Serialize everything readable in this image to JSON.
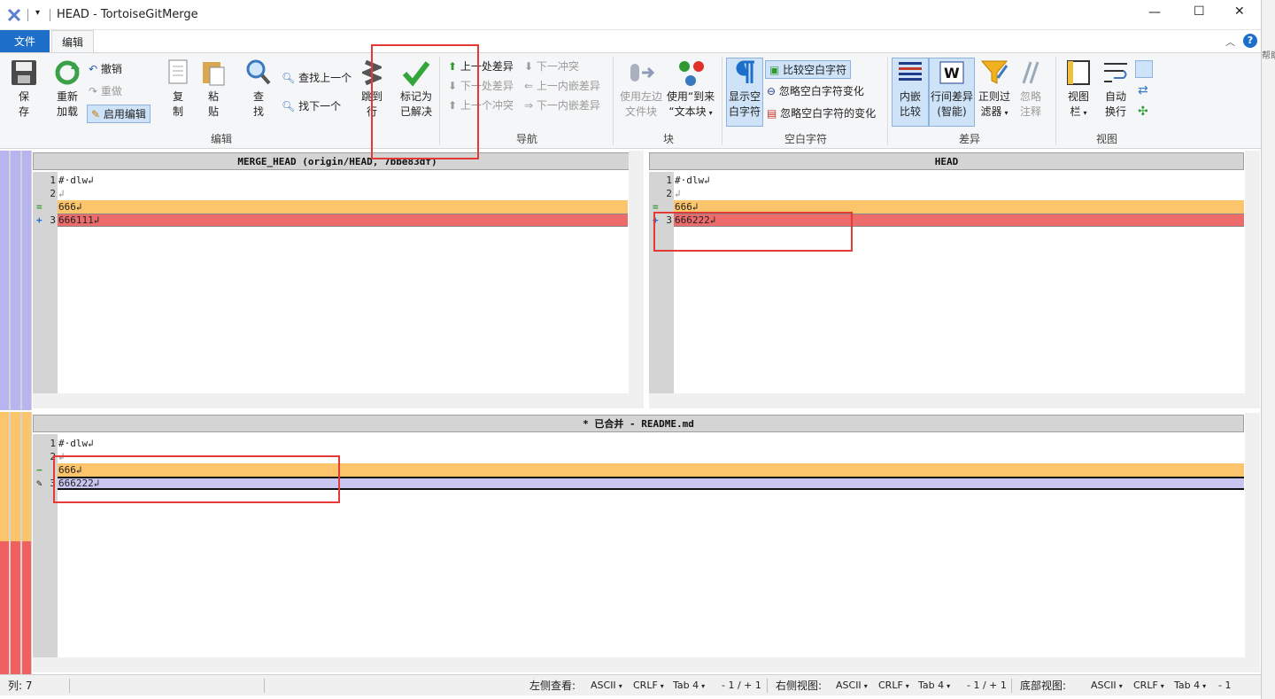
{
  "window": {
    "title": "HEAD - TortoiseGitMerge",
    "minimize": "—",
    "maximize": "☐",
    "close": "✕"
  },
  "ribbon_tabs": {
    "file": "文件",
    "edit": "编辑",
    "help_label": "帮助"
  },
  "ribbon": {
    "save": [
      "保",
      "存"
    ],
    "reload": [
      "重新",
      "加载"
    ],
    "undo": "撤销",
    "redo": "重做",
    "enable_edit": "启用编辑",
    "copy": [
      "复",
      "制"
    ],
    "paste": [
      "粘",
      "贴"
    ],
    "find": [
      "查",
      "找"
    ],
    "find_prev": "查找上一个",
    "find_next": "找下一个",
    "goto_line": [
      "跳到",
      "行"
    ],
    "mark_resolved": [
      "标记为",
      "已解决"
    ],
    "prev_diff": "上一处差异",
    "next_diff": "下一处差异",
    "prev_conflict": "上一个冲突",
    "next_conflict": "下一冲突",
    "prev_inline": "上一内嵌差异",
    "next_inline": "下一内嵌差异",
    "use_left": [
      "使用左边",
      "文件块"
    ],
    "use_them": [
      "使用“到来",
      "“文本块"
    ],
    "show_ws": [
      "显示空",
      "白字符"
    ],
    "compare_ws": "比较空白字符",
    "ignore_ws_change": "忽略空白字符变化",
    "ignore_all_ws": "忽略空白字符的变化",
    "inline_compare": [
      "内嵌",
      "比较"
    ],
    "line_diff": [
      "行间差异",
      "(智能)"
    ],
    "regex_filter": [
      "正则过",
      "滤器"
    ],
    "ignore_comments": [
      "忽略",
      "注释"
    ],
    "view_bar": [
      "视图",
      "栏"
    ],
    "auto_wrap": [
      "自动",
      "换行"
    ],
    "groups": {
      "edit": "编辑",
      "nav": "导航",
      "block": "块",
      "whitespace": "空白字符",
      "diff": "差异",
      "view": "视图"
    }
  },
  "left_pane": {
    "header": "MERGE_HEAD (origin/HEAD, 7bbe83df)",
    "lines": [
      {
        "num": "1",
        "text": "#·dlw↲",
        "marker": ""
      },
      {
        "num": "2",
        "text": "↲",
        "marker": ""
      },
      {
        "num": "",
        "text": "666↲",
        "marker": "="
      },
      {
        "num": "3",
        "text": "666111↲",
        "marker": "+"
      }
    ]
  },
  "right_pane": {
    "header": "HEAD",
    "lines": [
      {
        "num": "1",
        "text": "#·dlw↲",
        "marker": ""
      },
      {
        "num": "2",
        "text": "↲",
        "marker": ""
      },
      {
        "num": "",
        "text": "666↲",
        "marker": "="
      },
      {
        "num": "3",
        "text": "666222↲",
        "marker": "+"
      }
    ]
  },
  "bottom_pane": {
    "header": "* 已合并 - README.md",
    "lines": [
      {
        "num": "1",
        "text": "#·dlw↲",
        "marker": ""
      },
      {
        "num": "2",
        "text": "↲",
        "marker": ""
      },
      {
        "num": "",
        "text": "666↲",
        "marker": "−"
      },
      {
        "num": "3",
        "text": "666222↲",
        "marker": "✎"
      }
    ]
  },
  "status": {
    "col": "列: 7",
    "left_view_label": "左侧查看:",
    "right_view_label": "右侧视图:",
    "bottom_view_label": "底部视图:",
    "encoding": "ASCII",
    "eol": "CRLF",
    "tab": "Tab 4",
    "pos": "- 1 / + 1",
    "bottom_tab": "Tab 4",
    "bottom_pos": "- 1"
  },
  "colors": {
    "conflict_orange": "#fcc46b",
    "added_red": "#ee6b6b",
    "edited_lavender": "#c8c6f0",
    "left_strip_purple": "#b8b4f0",
    "bottom_strip_orange": "#fcc46b",
    "bottom_strip_red": "#f06060",
    "accent_blue": "#1e6fc9"
  }
}
